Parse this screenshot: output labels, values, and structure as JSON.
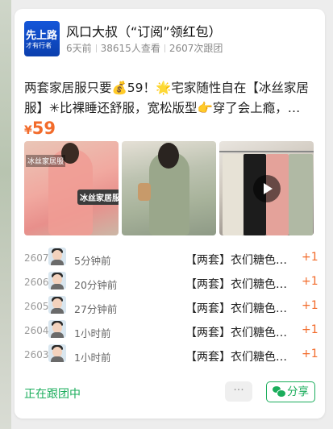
{
  "card": {
    "logo": {
      "line1": "先上路",
      "line2": "才有行者"
    },
    "title": "风口大叔（“订阅”领红包）",
    "meta": {
      "posted": "6天前",
      "views": "38615人查看",
      "joined": "2607次跟团"
    },
    "description": "两套家居服只要💰59！🌟宅家随性自在【冰丝家居服】✳比裸睡还舒服，宽松版型👉穿了会上瘾，…",
    "price": {
      "symbol": "¥",
      "value": "59"
    },
    "photos": [
      {
        "name": "photo-pink-set",
        "tag": "冰丝家居服",
        "label": "冰丝家居服"
      },
      {
        "name": "photo-green-set"
      },
      {
        "name": "photo-rack-video",
        "icon": "play-icon"
      }
    ]
  },
  "orders": [
    {
      "no": "2607",
      "time": "5分钟前",
      "item": "【两套】衣们糖色冰丝家居服",
      "qty": "+1"
    },
    {
      "no": "2606",
      "time": "20分钟前",
      "item": "【两套】衣们糖色冰丝家居服",
      "qty": "+1"
    },
    {
      "no": "2605",
      "time": "27分钟前",
      "item": "【两套】衣们糖色冰丝家居服",
      "qty": "+1"
    },
    {
      "no": "2604",
      "time": "1小时前",
      "item": "【两套】衣们糖色冰丝家居服",
      "qty": "+1"
    },
    {
      "no": "2603",
      "time": "1小时前",
      "item": "【两套】衣们糖色冰丝家居服",
      "qty": "+1"
    }
  ],
  "footer": {
    "status": "正在跟团中",
    "more": "···",
    "share": "分享",
    "share_icon": "wechat-icon"
  },
  "colors": {
    "accent": "#1aad5b",
    "price": "#f26b2b",
    "logo": "#1456d9"
  }
}
